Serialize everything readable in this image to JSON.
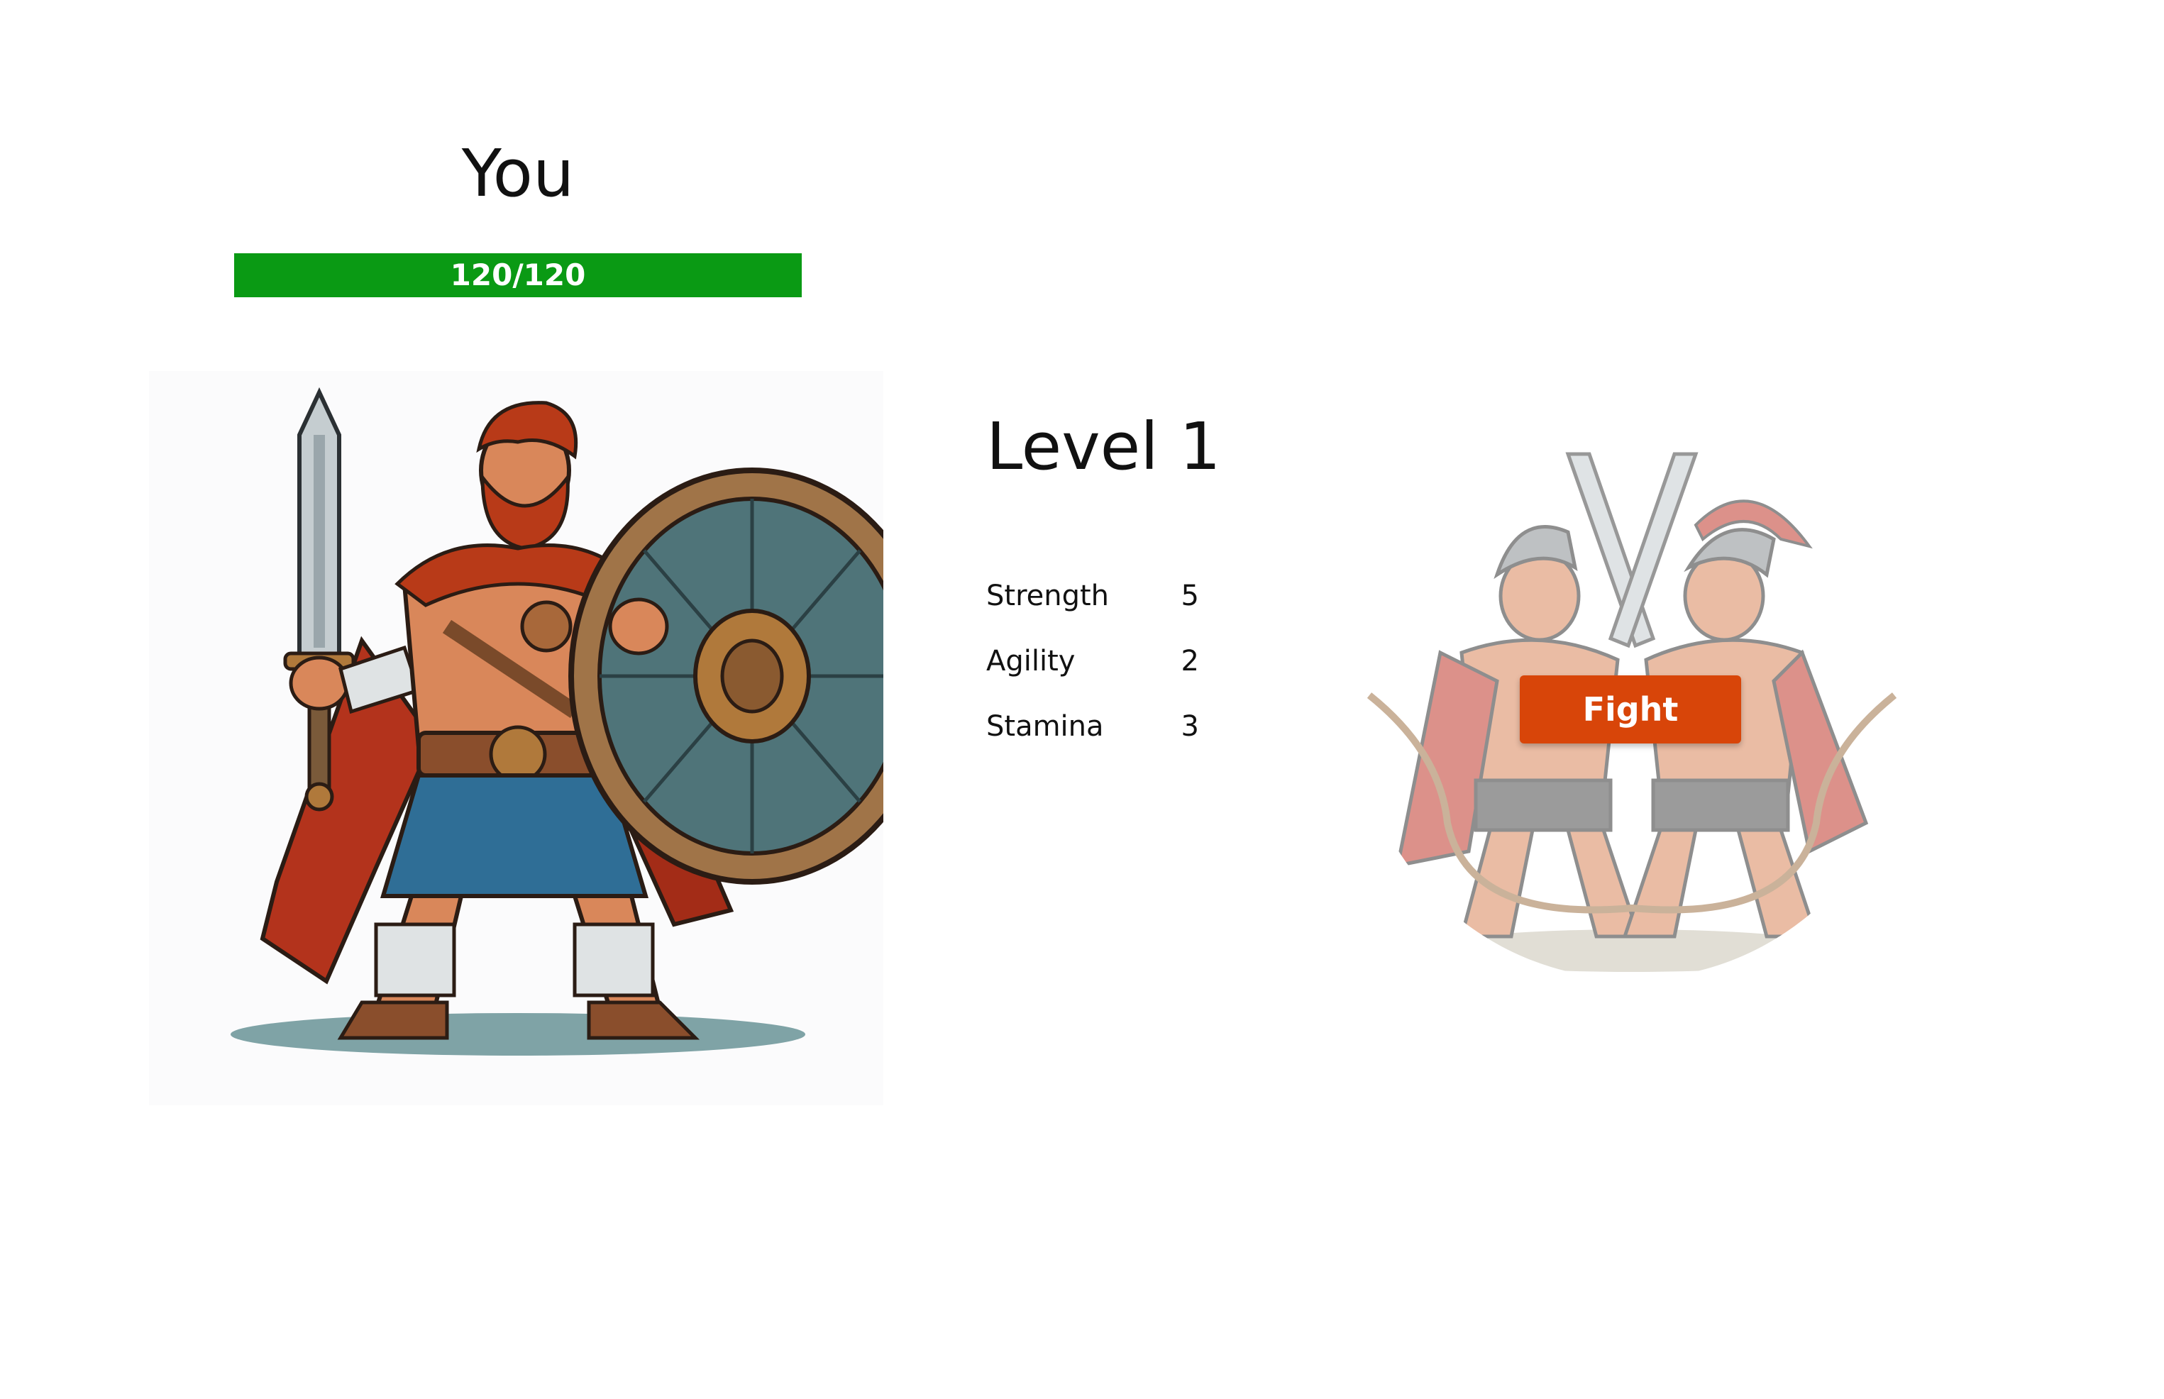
{
  "player": {
    "name": "You",
    "hp_text": "120/120",
    "hp_current": 120,
    "hp_max": 120,
    "hp_color": "#0a9a14",
    "portrait_icon": "gladiator-portrait"
  },
  "level": {
    "label": "Level 1"
  },
  "stats": [
    {
      "name": "Strength",
      "value": "5"
    },
    {
      "name": "Agility",
      "value": "2"
    },
    {
      "name": "Stamina",
      "value": "3"
    }
  ],
  "fight": {
    "button_label": "Fight",
    "button_color": "#d84509",
    "illustration_icon": "dueling-gladiators-illustration"
  }
}
